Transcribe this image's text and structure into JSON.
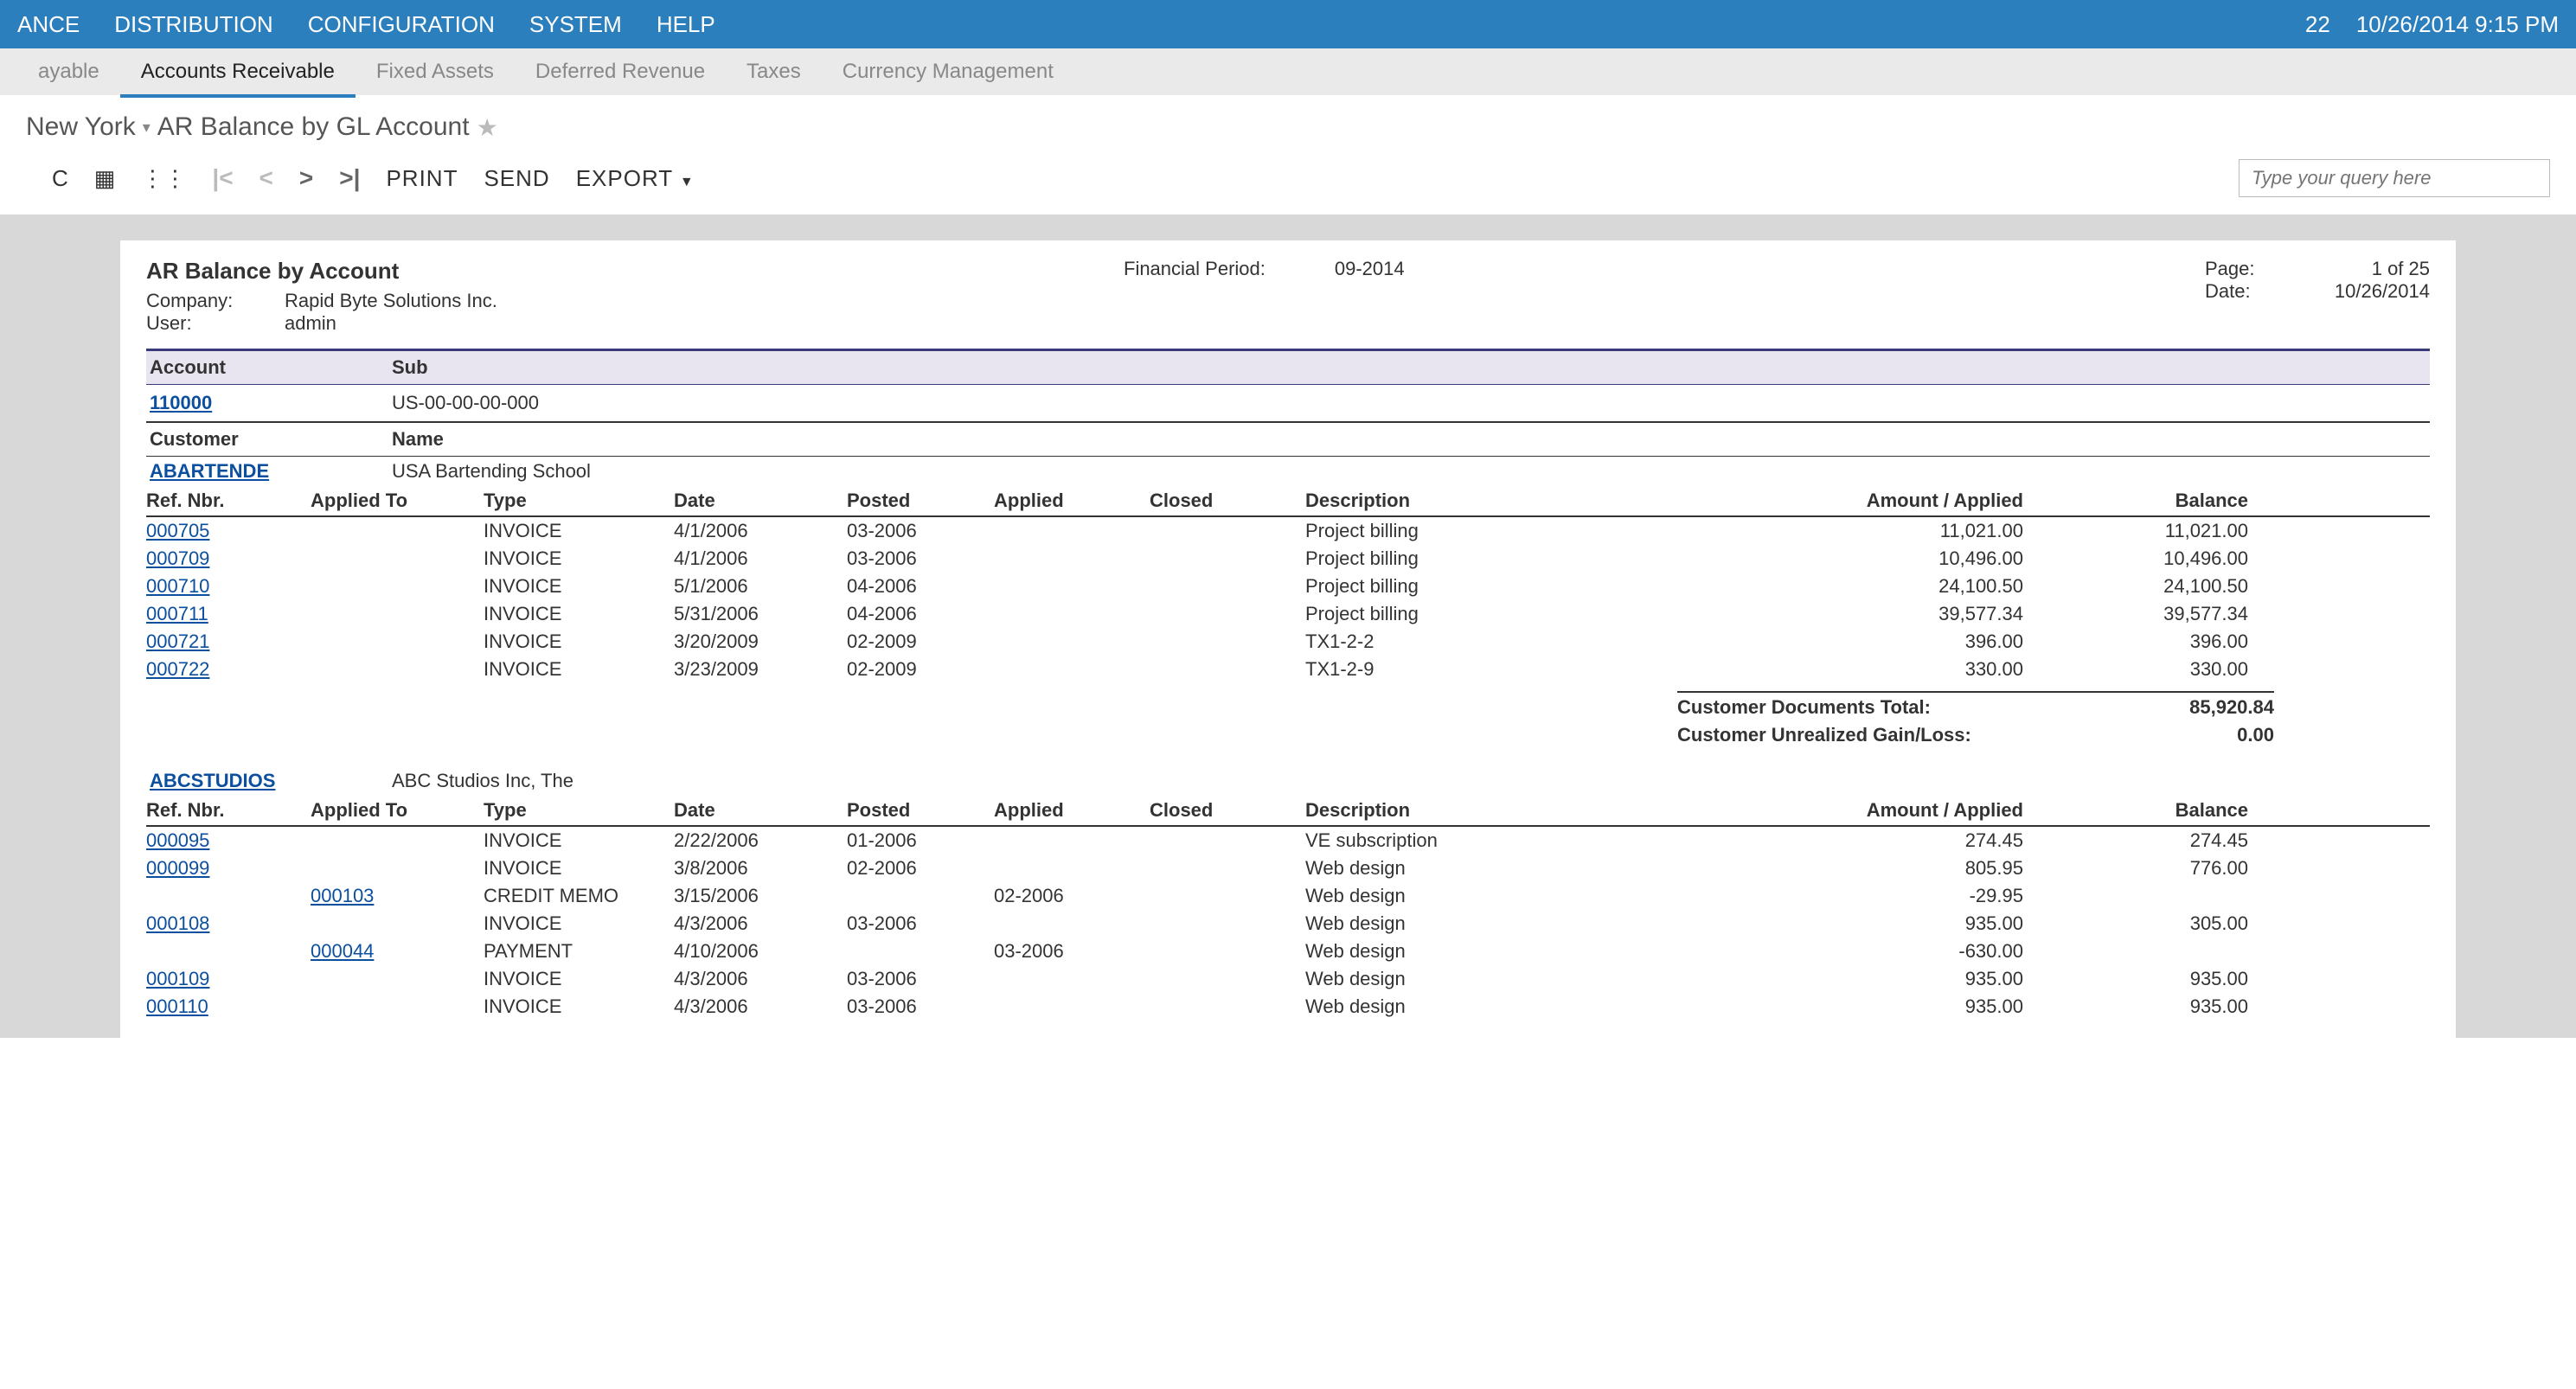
{
  "top_menu": {
    "items": [
      "ANCE",
      "DISTRIBUTION",
      "CONFIGURATION",
      "SYSTEM",
      "HELP"
    ],
    "badge": "22",
    "datetime": "10/26/2014  9:15 PM"
  },
  "sub_menu": {
    "items": [
      "ayable",
      "Accounts Receivable",
      "Fixed Assets",
      "Deferred Revenue",
      "Taxes",
      "Currency Management"
    ],
    "active_index": 1
  },
  "breadcrumb": {
    "branch": "New York",
    "title": "AR Balance by GL Account"
  },
  "toolbar": {
    "print": "PRINT",
    "send": "SEND",
    "export": "EXPORT",
    "query_placeholder": "Type your query here"
  },
  "report": {
    "title": "AR Balance by Account",
    "company_label": "Company:",
    "company": "Rapid Byte Solutions Inc.",
    "user_label": "User:",
    "user": "admin",
    "fin_period_label": "Financial Period:",
    "fin_period": "09-2014",
    "page_label": "Page:",
    "page": "1 of 25",
    "date_label": "Date:",
    "date": "10/26/2014",
    "account_hdr": "Account",
    "sub_hdr": "Sub",
    "account": "110000",
    "sub": "US-00-00-00-000",
    "customer_hdr": "Customer",
    "name_hdr": "Name",
    "col": {
      "ref": "Ref. Nbr.",
      "applied_to": "Applied To",
      "type": "Type",
      "date": "Date",
      "posted": "Posted",
      "applied": "Applied",
      "closed": "Closed",
      "desc": "Description",
      "amount": "Amount / Applied",
      "balance": "Balance"
    },
    "customers": [
      {
        "id": "ABARTENDE",
        "name": "USA Bartending School",
        "rows": [
          {
            "ref": "000705",
            "applied_to": "",
            "type": "INVOICE",
            "date": "4/1/2006",
            "posted": "03-2006",
            "applied": "",
            "closed": "",
            "desc": "Project billing",
            "amount": "11,021.00",
            "balance": "11,021.00"
          },
          {
            "ref": "000709",
            "applied_to": "",
            "type": "INVOICE",
            "date": "4/1/2006",
            "posted": "03-2006",
            "applied": "",
            "closed": "",
            "desc": "Project billing",
            "amount": "10,496.00",
            "balance": "10,496.00"
          },
          {
            "ref": "000710",
            "applied_to": "",
            "type": "INVOICE",
            "date": "5/1/2006",
            "posted": "04-2006",
            "applied": "",
            "closed": "",
            "desc": "Project billing",
            "amount": "24,100.50",
            "balance": "24,100.50"
          },
          {
            "ref": "000711",
            "applied_to": "",
            "type": "INVOICE",
            "date": "5/31/2006",
            "posted": "04-2006",
            "applied": "",
            "closed": "",
            "desc": "Project billing",
            "amount": "39,577.34",
            "balance": "39,577.34"
          },
          {
            "ref": "000721",
            "applied_to": "",
            "type": "INVOICE",
            "date": "3/20/2009",
            "posted": "02-2009",
            "applied": "",
            "closed": "",
            "desc": "TX1-2-2",
            "amount": "396.00",
            "balance": "396.00"
          },
          {
            "ref": "000722",
            "applied_to": "",
            "type": "INVOICE",
            "date": "3/23/2009",
            "posted": "02-2009",
            "applied": "",
            "closed": "",
            "desc": "TX1-2-9",
            "amount": "330.00",
            "balance": "330.00"
          }
        ],
        "totals": {
          "docs_label": "Customer Documents Total:",
          "docs_value": "85,920.84",
          "gain_label": "Customer Unrealized Gain/Loss:",
          "gain_value": "0.00"
        }
      },
      {
        "id": "ABCSTUDIOS",
        "name": "ABC Studios Inc, The",
        "rows": [
          {
            "ref": "000095",
            "applied_to": "",
            "type": "INVOICE",
            "date": "2/22/2006",
            "posted": "01-2006",
            "applied": "",
            "closed": "",
            "desc": "VE subscription",
            "amount": "274.45",
            "balance": "274.45"
          },
          {
            "ref": "000099",
            "applied_to": "",
            "type": "INVOICE",
            "date": "3/8/2006",
            "posted": "02-2006",
            "applied": "",
            "closed": "",
            "desc": "Web design",
            "amount": "805.95",
            "balance": "776.00"
          },
          {
            "ref": "",
            "applied_to": "000103",
            "type": "CREDIT MEMO",
            "date": "3/15/2006",
            "posted": "",
            "applied": "02-2006",
            "closed": "",
            "desc": "Web design",
            "amount": "-29.95",
            "balance": ""
          },
          {
            "ref": "000108",
            "applied_to": "",
            "type": "INVOICE",
            "date": "4/3/2006",
            "posted": "03-2006",
            "applied": "",
            "closed": "",
            "desc": "Web design",
            "amount": "935.00",
            "balance": "305.00"
          },
          {
            "ref": "",
            "applied_to": "000044",
            "type": "PAYMENT",
            "date": "4/10/2006",
            "posted": "",
            "applied": "03-2006",
            "closed": "",
            "desc": "Web design",
            "amount": "-630.00",
            "balance": ""
          },
          {
            "ref": "000109",
            "applied_to": "",
            "type": "INVOICE",
            "date": "4/3/2006",
            "posted": "03-2006",
            "applied": "",
            "closed": "",
            "desc": "Web design",
            "amount": "935.00",
            "balance": "935.00"
          },
          {
            "ref": "000110",
            "applied_to": "",
            "type": "INVOICE",
            "date": "4/3/2006",
            "posted": "03-2006",
            "applied": "",
            "closed": "",
            "desc": "Web design",
            "amount": "935.00",
            "balance": "935.00"
          }
        ]
      }
    ]
  }
}
